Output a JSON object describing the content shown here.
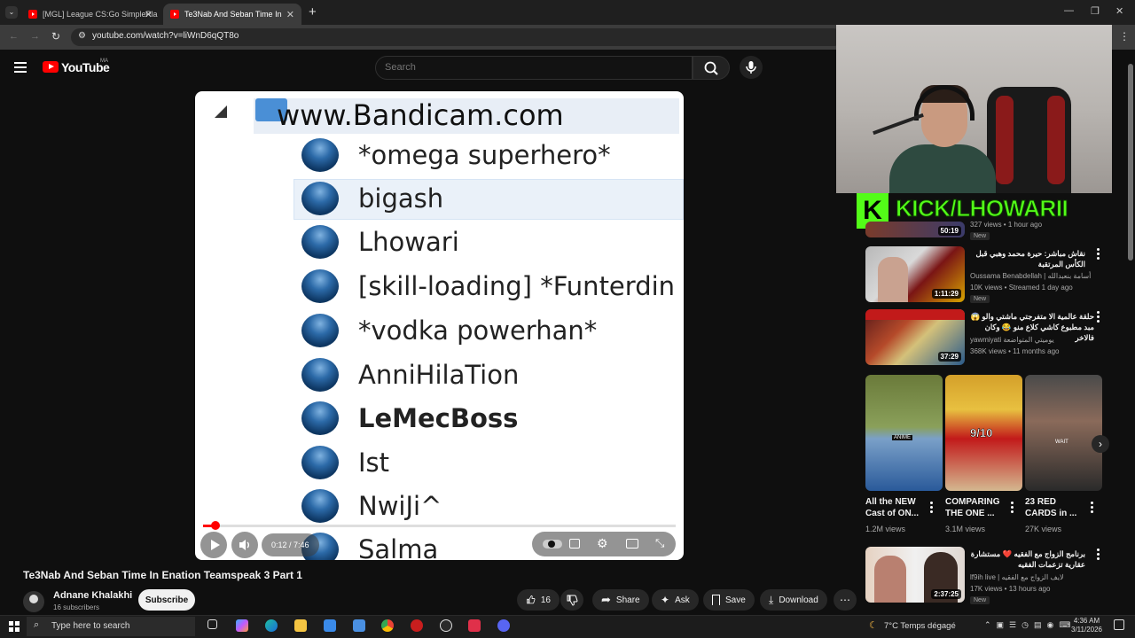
{
  "browser": {
    "tabs": [
      {
        "label": "[MGL] League CS:Go SimplePla",
        "active": false
      },
      {
        "label": "Te3Nab And Seban Time In",
        "active": true
      }
    ],
    "new_tab": "+",
    "url": "youtube.com/watch?v=liWnD6qQT8o"
  },
  "header": {
    "logo_text": "YouTube",
    "region": "MA",
    "search_placeholder": "Search"
  },
  "player": {
    "watermark": "www.Bandicam.com",
    "teamspeak_users": [
      {
        "name": "*omega superhero*",
        "bold": false
      },
      {
        "name": "bigash",
        "bold": false,
        "selected": true
      },
      {
        "name": "Lhowari",
        "bold": false
      },
      {
        "name": "[skill-loading] *Funterdin",
        "bold": false
      },
      {
        "name": "*vodka powerhan*",
        "bold": false
      },
      {
        "name": "AnniHilaTion",
        "bold": false
      },
      {
        "name": "LeMecBoss",
        "bold": true
      },
      {
        "name": "Ist",
        "bold": false
      },
      {
        "name": "NwiJi^",
        "bold": false
      },
      {
        "name": "Salma",
        "bold": false
      }
    ],
    "time": "0:12 / 7:46",
    "progress": 0.026
  },
  "video": {
    "title": "Te3Nab And Seban Time In Enation Teamspeak 3 Part 1",
    "channel": "Adnane Khalakhi",
    "subscribers": "16 subscribers",
    "subscribe_label": "Subscribe",
    "likes": "16",
    "share_label": "Share",
    "ask_label": "Ask",
    "save_label": "Save",
    "download_label": "Download"
  },
  "overlay": {
    "kick_letter": "K",
    "kick_text": "KICK/LHOWARII"
  },
  "recommendations": [
    {
      "title": "",
      "meta": "327 views • 1 hour ago",
      "badge": "New",
      "duration": "50:19"
    },
    {
      "title": "نقاش مباشر: حيرة محمد وهبي قبل الكأس المرتقبة",
      "channel": "Oussama Benabdellah | أسامة بنعبدالله",
      "meta": "10K views • Streamed 1 day ago",
      "badge": "New",
      "duration": "1:11:29"
    },
    {
      "title": "حلقة عالمية الا متفرجتي ماشتي والو 😱 مبد مطبوع كاشي كلاع منو 😂 وكان فالاخر",
      "channel": "yawmiyati يوميتي المتواضعة",
      "meta": "368K views • 11 months ago",
      "duration": "37:29"
    },
    {
      "title": "برنامج الزواج مع الفقيه ❤️ مستشارة عقارية تزعمات الفقيه",
      "channel": "lf9ih live | لايف الزواج مع الفقيه",
      "meta": "17K views • 13 hours ago",
      "badge": "New",
      "duration": "2:37:25"
    }
  ],
  "shorts": [
    {
      "title": "All the NEW Cast of ON...",
      "views": "1.2M views"
    },
    {
      "title": "COMPARING THE ONE ...",
      "views": "3.1M views"
    },
    {
      "title": "23 RED CARDS in ...",
      "views": "27K views"
    }
  ],
  "shorts_badges": {
    "anime": "ANIME",
    "rating": "9/10",
    "wait": "WAIT"
  },
  "taskbar": {
    "search_placeholder": "Type here to search",
    "weather": "7°C  Temps dégagé",
    "time": "4:36 AM",
    "date": "3/11/2026"
  }
}
